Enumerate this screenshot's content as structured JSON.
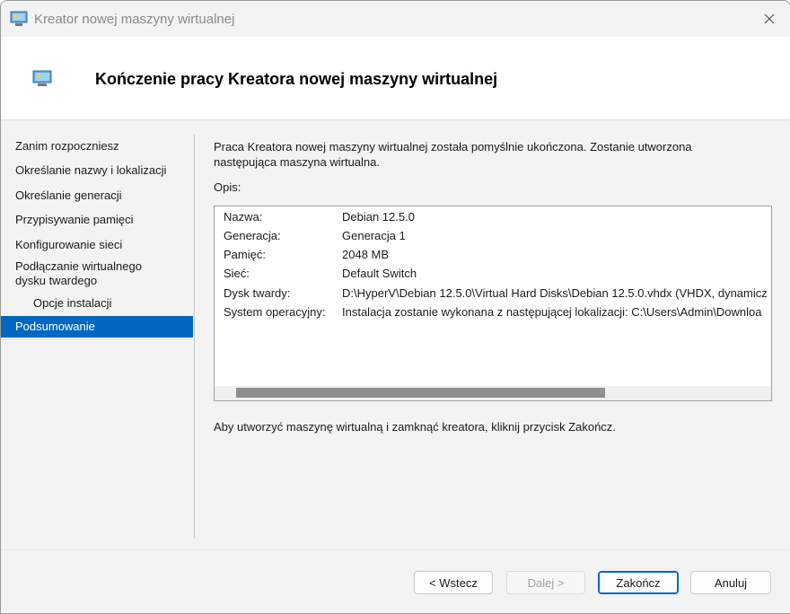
{
  "window": {
    "title": "Kreator nowej maszyny wirtualnej",
    "header_title": "Kończenie pracy Kreatora nowej maszyny wirtualnej",
    "accent_color": "#0067c0"
  },
  "sidebar": {
    "items": [
      {
        "label": "Zanim rozpoczniesz"
      },
      {
        "label": "Określanie nazwy i lokalizacji"
      },
      {
        "label": "Określanie generacji"
      },
      {
        "label": "Przypisywanie pamięci"
      },
      {
        "label": "Konfigurowanie sieci"
      },
      {
        "label": "Podłączanie wirtualnego dysku twardego"
      },
      {
        "label": "Opcje instalacji"
      },
      {
        "label": "Podsumowanie",
        "active": true
      }
    ]
  },
  "main": {
    "intro": "Praca Kreatora nowej maszyny wirtualnej została pomyślnie ukończona. Zostanie utworzona następująca maszyna wirtualna.",
    "description_label": "Opis:",
    "summary": [
      {
        "key": "Nazwa:",
        "value": "Debian 12.5.0"
      },
      {
        "key": "Generacja:",
        "value": "Generacja 1"
      },
      {
        "key": "Pamięć:",
        "value": "2048 MB"
      },
      {
        "key": "Sieć:",
        "value": "Default Switch"
      },
      {
        "key": "Dysk twardy:",
        "value": "D:\\HyperV\\Debian 12.5.0\\Virtual Hard Disks\\Debian 12.5.0.vhdx (VHDX, dynamicz"
      },
      {
        "key": "System operacyjny:",
        "value": "Instalacja zostanie wykonana z następującej lokalizacji: C:\\Users\\Admin\\Downloa"
      }
    ],
    "finish_note": "Aby utworzyć maszynę wirtualną i zamknąć kreatora, kliknij przycisk Zakończ."
  },
  "buttons": {
    "back": "< Wstecz",
    "next": "Dalej >",
    "finish": "Zakończ",
    "cancel": "Anuluj"
  }
}
